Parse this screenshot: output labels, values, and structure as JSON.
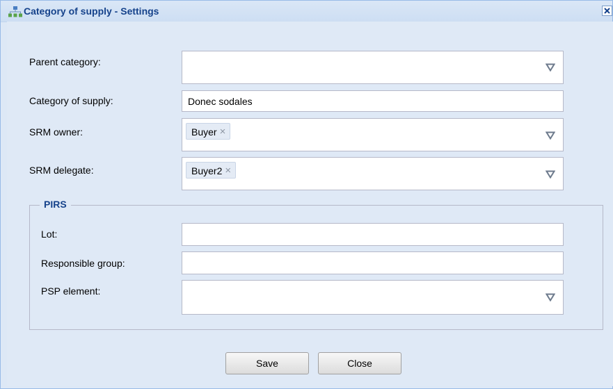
{
  "window": {
    "title": "Category of supply - Settings",
    "title_icon": "hierarchy-icon",
    "close_icon": "close-icon"
  },
  "form": {
    "parent_category": {
      "label": "Parent category:",
      "value": ""
    },
    "category_of_supply": {
      "label": "Category of supply:",
      "value": "Donec sodales"
    },
    "srm_owner": {
      "label": "SRM owner:",
      "tags": [
        "Buyer"
      ]
    },
    "srm_delegate": {
      "label": "SRM delegate:",
      "tags": [
        "Buyer2"
      ]
    }
  },
  "pirs": {
    "legend": "PIRS",
    "lot": {
      "label": "Lot:",
      "value": ""
    },
    "responsible_group": {
      "label": "Responsible group:",
      "value": ""
    },
    "psp_element": {
      "label": "PSP element:",
      "value": ""
    }
  },
  "buttons": {
    "save": "Save",
    "close": "Close"
  },
  "colors": {
    "title_text": "#15428b",
    "window_background": "#dfe9f6",
    "field_border": "#b5b8c8"
  }
}
